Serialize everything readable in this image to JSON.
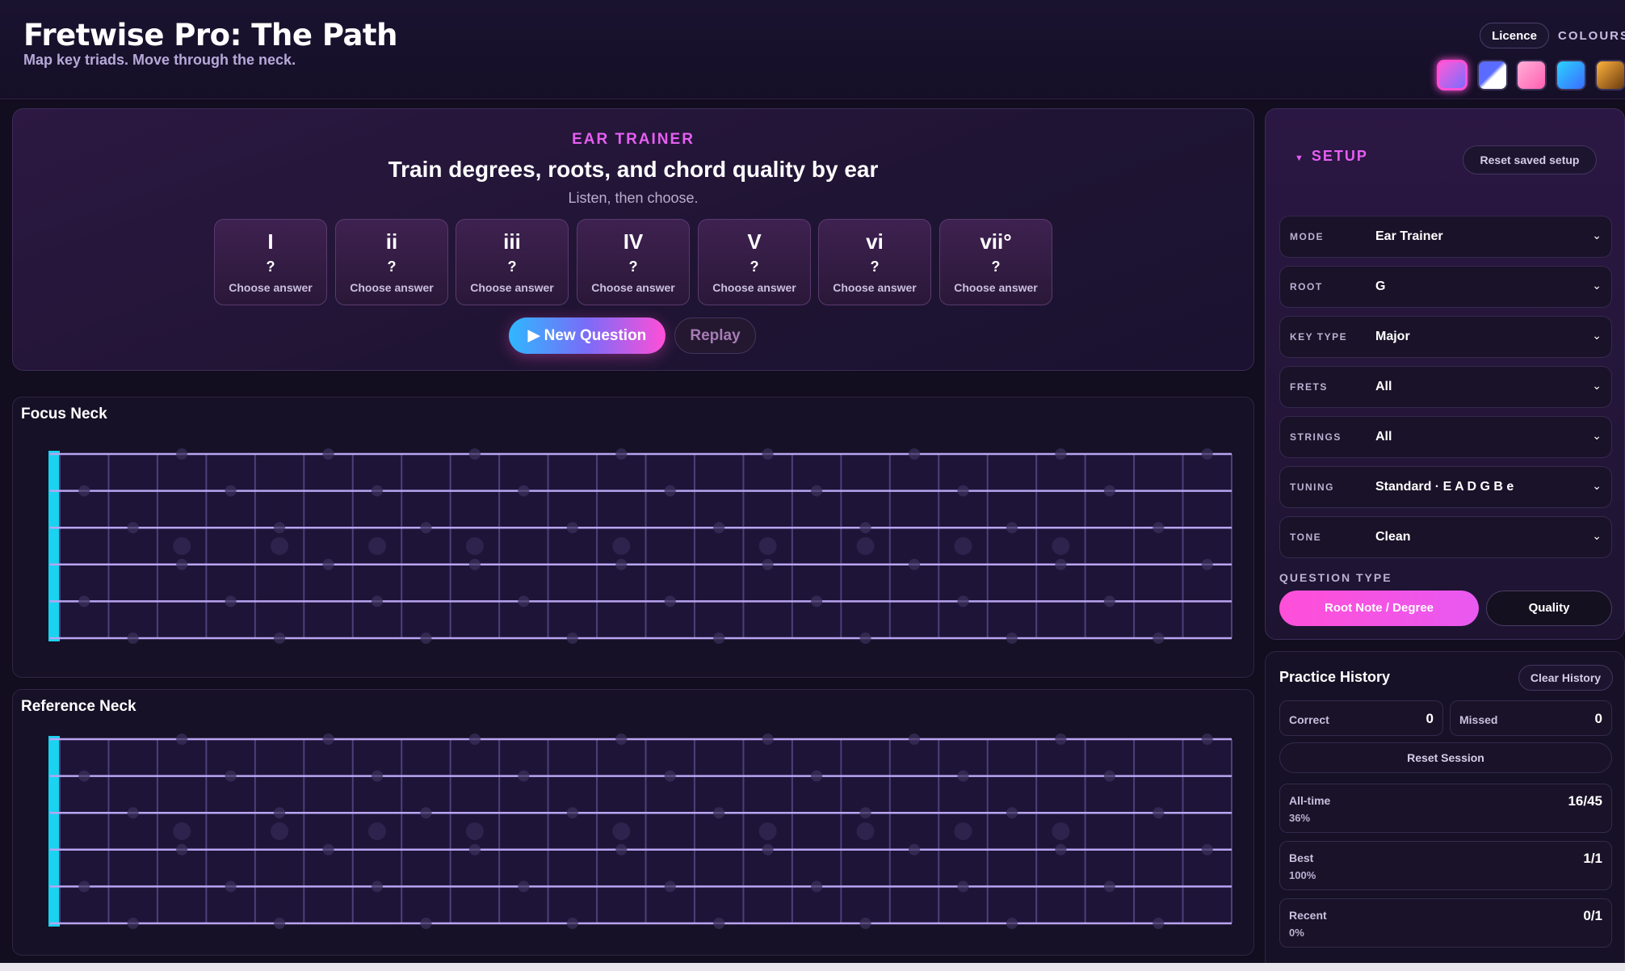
{
  "header": {
    "title": "Fretwise Pro: The Path",
    "subtitle": "Map key triads. Move through the neck.",
    "licence_label": "Licence",
    "colours_label": "COLOURS"
  },
  "colour_swatches": [
    {
      "name": "magenta",
      "active": true
    },
    {
      "name": "blue-white"
    },
    {
      "name": "pink"
    },
    {
      "name": "cyan"
    },
    {
      "name": "amber"
    }
  ],
  "ear_trainer": {
    "kicker": "EAR TRAINER",
    "title": "Train degrees, roots, and chord quality by ear",
    "subtitle": "Listen, then choose.",
    "degrees": [
      {
        "numeral": "I",
        "answer": "?",
        "hint": "Choose answer"
      },
      {
        "numeral": "ii",
        "answer": "?",
        "hint": "Choose answer"
      },
      {
        "numeral": "iii",
        "answer": "?",
        "hint": "Choose answer"
      },
      {
        "numeral": "IV",
        "answer": "?",
        "hint": "Choose answer"
      },
      {
        "numeral": "V",
        "answer": "?",
        "hint": "Choose answer"
      },
      {
        "numeral": "vi",
        "answer": "?",
        "hint": "Choose answer"
      },
      {
        "numeral": "vii°",
        "answer": "?",
        "hint": "Choose answer"
      }
    ],
    "new_question_label": "New Question",
    "replay_label": "Replay"
  },
  "necks": {
    "focus_title": "Focus Neck",
    "reference_title": "Reference Neck"
  },
  "setup": {
    "title": "SETUP",
    "reset_label": "Reset saved setup",
    "fields": [
      {
        "label": "MODE",
        "value": "Ear Trainer"
      },
      {
        "label": "ROOT",
        "value": "G"
      },
      {
        "label": "KEY TYPE",
        "value": "Major"
      },
      {
        "label": "FRETS",
        "value": "All"
      },
      {
        "label": "STRINGS",
        "value": "All"
      },
      {
        "label": "TUNING",
        "value": "Standard · E A D G B e"
      },
      {
        "label": "TONE",
        "value": "Clean"
      }
    ],
    "question_type_label": "QUESTION TYPE",
    "question_types": [
      "Root Note / Degree",
      "Quality"
    ],
    "selected_question_type": "Root Note / Degree"
  },
  "history": {
    "title": "Practice History",
    "clear_label": "Clear History",
    "correct_label": "Correct",
    "correct_value": "0",
    "missed_label": "Missed",
    "missed_value": "0",
    "reset_session_label": "Reset Session",
    "tallies": [
      {
        "label": "All-time",
        "pct": "36%",
        "value": "16/45"
      },
      {
        "label": "Best",
        "pct": "100%",
        "value": "1/1"
      },
      {
        "label": "Recent",
        "pct": "0%",
        "value": "0/1"
      }
    ]
  },
  "colors": {
    "accent": "#e65ff2",
    "cyan": "#19d3f0",
    "background": "#120d1f"
  }
}
